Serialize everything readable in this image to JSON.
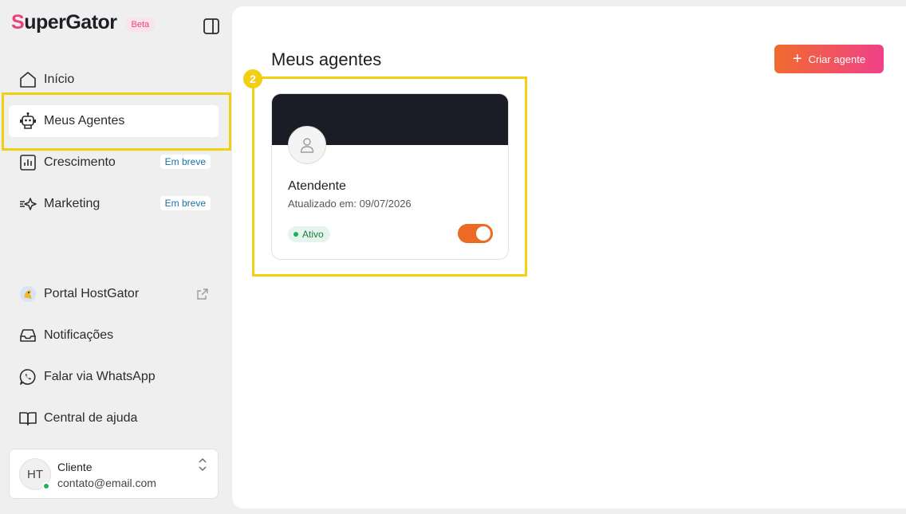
{
  "brand": {
    "logo_first": "S",
    "logo_rest": "uperGator",
    "beta": "Beta"
  },
  "nav": {
    "inicio": "Início",
    "meus_agentes": "Meus Agentes",
    "crescimento": "Crescimento",
    "marketing": "Marketing",
    "soon": "Em breve",
    "portal": "Portal HostGator",
    "notificacoes": "Notificações",
    "whatsapp": "Falar via WhatsApp",
    "ajuda": "Central de ajuda"
  },
  "user": {
    "initials": "HT",
    "name": "Cliente",
    "email": "contato@email.com"
  },
  "main": {
    "title": "Meus agentes",
    "create_label": "Criar agente",
    "step": "2"
  },
  "agent": {
    "name": "Atendente",
    "updated": "Atualizado em: 09/07/2026",
    "status": "Ativo",
    "enabled": true
  },
  "colors": {
    "accent": "#ec6b24",
    "highlight": "#f1cf14",
    "brand_pink": "#ee3f7a"
  }
}
